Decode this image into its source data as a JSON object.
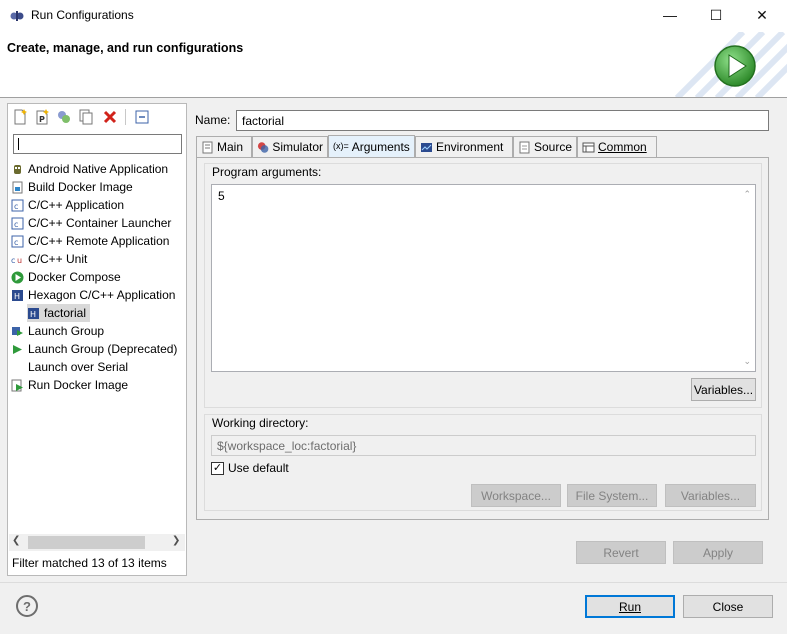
{
  "window": {
    "title": "Run Configurations",
    "minimize": "—",
    "maximize": "☐",
    "close": "✕"
  },
  "banner": {
    "title": "Create, manage, and run configurations"
  },
  "left": {
    "toolbar": [
      "new-launch-configuration-icon",
      "new-prototype-icon",
      "export-icon",
      "duplicate-icon",
      "delete-icon",
      "collapse-all-icon"
    ],
    "filter_value": "",
    "tree": [
      {
        "label": "Android Native Application",
        "icon": "android-icon"
      },
      {
        "label": "Build Docker Image",
        "icon": "docker-build-icon"
      },
      {
        "label": "C/C++ Application",
        "icon": "c-app-icon"
      },
      {
        "label": "C/C++ Container Launcher",
        "icon": "c-container-icon"
      },
      {
        "label": "C/C++ Remote Application",
        "icon": "c-remote-icon"
      },
      {
        "label": "C/C++ Unit",
        "icon": "c-unit-icon"
      },
      {
        "label": "Docker Compose",
        "icon": "docker-compose-icon"
      },
      {
        "label": "Hexagon C/C++ Application",
        "icon": "hexagon-icon"
      },
      {
        "label": "factorial",
        "icon": "hexagon-config-icon"
      },
      {
        "label": "Launch Group",
        "icon": "launch-group-icon"
      },
      {
        "label": "Launch Group (Deprecated)",
        "icon": "launch-group-deprecated-icon"
      },
      {
        "label": "Launch over Serial",
        "icon": ""
      },
      {
        "label": "Run Docker Image",
        "icon": "docker-run-icon"
      }
    ],
    "filter_status": "Filter matched 13 of 13 items"
  },
  "config": {
    "name_label": "Name:",
    "name_value": "factorial",
    "tabs": [
      {
        "label": "Main",
        "icon": "main-tab-icon"
      },
      {
        "label": "Simulator",
        "icon": "simulator-tab-icon"
      },
      {
        "label": "Arguments",
        "icon": "arguments-tab-icon"
      },
      {
        "label": "Environment",
        "icon": "environment-tab-icon"
      },
      {
        "label": "Source",
        "icon": "source-tab-icon"
      },
      {
        "label": "Common",
        "icon": "common-tab-icon"
      }
    ],
    "active_tab": "Arguments",
    "program_arguments_label": "Program arguments:",
    "program_arguments_value": "5",
    "variables_button": "Variables...",
    "working_directory_label": "Working directory:",
    "working_directory_value": "${workspace_loc:factorial}",
    "use_default_label": "Use default",
    "use_default_checked": true,
    "workspace_button": "Workspace...",
    "file_system_button": "File System...",
    "variables2_button": "Variables..."
  },
  "footer": {
    "revert": "Revert",
    "apply": "Apply",
    "run": "Run",
    "close": "Close",
    "help": "?"
  }
}
